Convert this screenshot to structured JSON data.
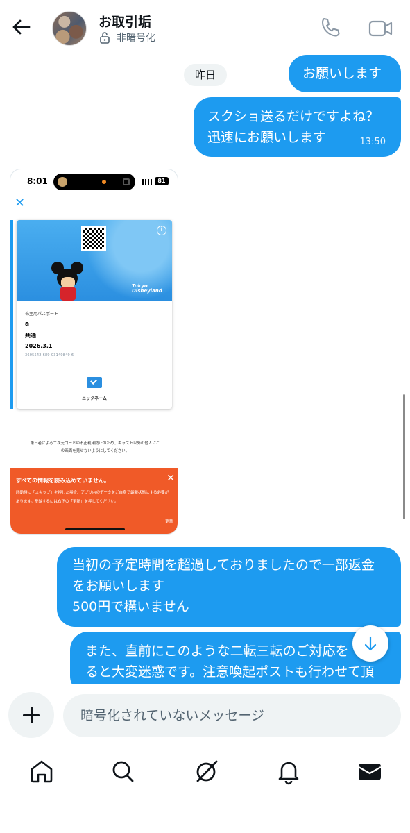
{
  "header": {
    "back_icon": "arrow-left-icon",
    "title": "お取引垢",
    "encryption_label": "非暗号化",
    "lock_icon": "unlock-icon",
    "call_icon": "phone-icon",
    "video_icon": "video-camera-icon"
  },
  "conversation": {
    "date_divider": "昨日",
    "messages": [
      {
        "text_lines": [
          "お願いします"
        ],
        "from": "me"
      },
      {
        "text_lines": [
          "スクショ送るだけですよね？",
          "迅速にお願いします"
        ],
        "time": "13:50",
        "from": "me"
      },
      {
        "text_lines": [
          "当初の予定時間を超過しておりましたので一部返金",
          "をお願いします",
          "500円で構いません"
        ],
        "from": "me"
      },
      {
        "text_lines": [
          "また、直前にこのような二転三転のご対応を",
          "ると大変迷惑です。注意喚起ポストも行わせて頂"
        ],
        "from": "me"
      }
    ]
  },
  "attachment": {
    "status_time": "8:01",
    "battery": "81",
    "close_glyph": "✕",
    "info_glyph": "i",
    "park_logo": [
      "Tokyo",
      "Disneyland"
    ],
    "ticket_type": "株主用パスポート",
    "holder_name": "a",
    "ticket_common": "共通",
    "ticket_date": "2026.3.1",
    "ticket_id": "3605542-689-03149849-6",
    "nickname_label": "ニックネーム",
    "notice": "第三者による二次元コードの不正利用防止のため、キャスト以外の他人にこの画面を見せないようにしてください。",
    "banner_title": "すべての情報を読み込めていません。",
    "banner_body": "起動時に「スキップ」を押した場合、アプリ内のデータをご自身で最新状態にする必要があります。反映するには右下の「更新」を押してください。",
    "banner_update": "更新",
    "banner_close": "✕"
  },
  "jump_icon": "arrow-down-icon",
  "composer": {
    "add_icon": "plus-icon",
    "placeholder": "暗号化されていないメッセージ"
  },
  "nav": {
    "items": [
      "home-icon",
      "search-icon",
      "grok-icon",
      "notifications-icon",
      "messages-icon"
    ]
  },
  "colors": {
    "accent": "#1d9bf0",
    "banner": "#f05a28"
  }
}
